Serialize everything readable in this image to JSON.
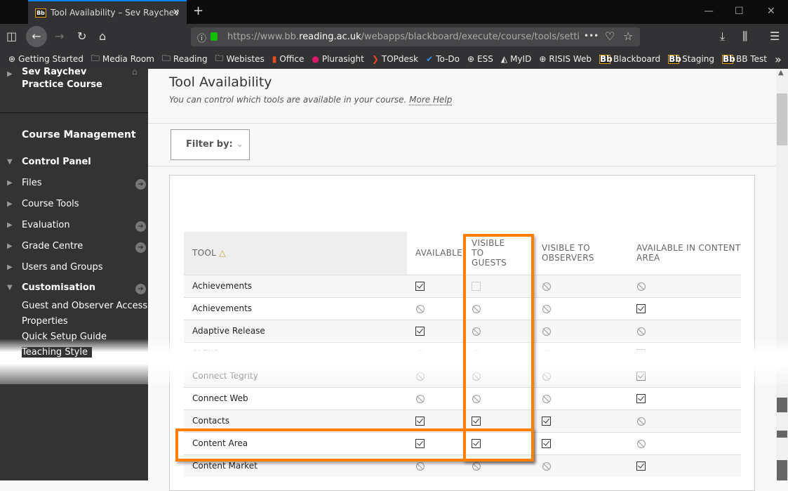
{
  "browser": {
    "tab_title": "Tool Availability – Sev Raychev",
    "url_pre": "https://www.bb.",
    "url_domain": "reading.ac.uk",
    "url_post": "/webapps/blackboard/execute/course/tools/setti",
    "bookmarks": [
      {
        "label": "Getting Started",
        "icon": "globe-icon"
      },
      {
        "label": "Media Room",
        "icon": "folder-icon"
      },
      {
        "label": "Reading",
        "icon": "folder-icon"
      },
      {
        "label": "Webistes",
        "icon": "folder-icon"
      },
      {
        "label": "Office",
        "icon": "office-icon"
      },
      {
        "label": "Plurasight",
        "icon": "pluralsight-icon"
      },
      {
        "label": "TOPdesk",
        "icon": "topdesk-icon"
      },
      {
        "label": "To-Do",
        "icon": "todo-icon"
      },
      {
        "label": "ESS",
        "icon": "globe-icon"
      },
      {
        "label": "MyID",
        "icon": "myid-icon"
      },
      {
        "label": "RISIS Web",
        "icon": "globe-icon"
      },
      {
        "label": "Blackboard",
        "icon": "bb-icon"
      },
      {
        "label": "Staging",
        "icon": "bb-icon"
      },
      {
        "label": "BB Test",
        "icon": "bb-icon"
      }
    ]
  },
  "sidebar": {
    "course": "Sev Raychev Practice Course",
    "section": "Course Management",
    "control_panel": "Control Panel",
    "items": [
      "Files",
      "Course Tools",
      "Evaluation",
      "Grade Centre",
      "Users and Groups"
    ],
    "customisation": "Customisation",
    "sub_items": [
      "Guest and Observer Access",
      "Properties",
      "Quick Setup Guide",
      "Teaching Style"
    ]
  },
  "page": {
    "title": "Tool Availability",
    "subtitle": "You can control which tools are available in your course.",
    "help": "More Help",
    "filter": "Filter by:"
  },
  "table": {
    "headers": [
      "TOOL",
      "AVAILABLE",
      "VISIBLE TO GUESTS",
      "VISIBLE TO OBSERVERS",
      "AVAILABLE IN CONTENT AREA"
    ],
    "rows": [
      {
        "tool": "Achievements",
        "cells": [
          "checked",
          "unchecked",
          "na",
          "na"
        ]
      },
      {
        "tool": "Achievements",
        "cells": [
          "na",
          "na",
          "na",
          "checked"
        ]
      },
      {
        "tool": "Adaptive Release",
        "cells": [
          "checked",
          "na",
          "na",
          "na"
        ]
      },
      {
        "tool": "ALEKS",
        "cells": [
          "na",
          "na",
          "na",
          "checked"
        ]
      },
      {
        "tool": "Connect Tegrity",
        "cells": [
          "na",
          "na",
          "na",
          "checked"
        ]
      },
      {
        "tool": "Connect Web",
        "cells": [
          "na",
          "na",
          "na",
          "checked"
        ]
      },
      {
        "tool": "Contacts",
        "cells": [
          "checked",
          "checked",
          "checked",
          "na"
        ]
      },
      {
        "tool": "Content Area",
        "cells": [
          "checked",
          "checked",
          "checked",
          "na"
        ]
      },
      {
        "tool": "Content Market",
        "cells": [
          "na",
          "na",
          "na",
          "checked"
        ]
      }
    ]
  },
  "colors": {
    "highlight": "#ff8000",
    "sidebar": "#333333"
  }
}
